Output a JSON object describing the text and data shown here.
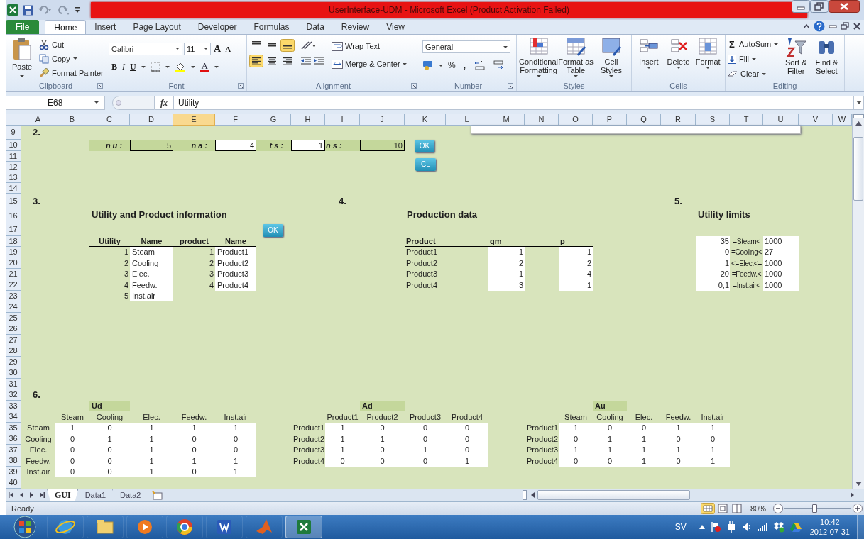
{
  "window": {
    "title": "UserInterface-UDM  -  Microsoft Excel (Product Activation Failed)"
  },
  "ribbon": {
    "tabs": [
      {
        "label": "File",
        "kind": "file",
        "selected": false
      },
      {
        "label": "Home",
        "kind": "tab",
        "selected": true
      },
      {
        "label": "Insert",
        "kind": "tab",
        "selected": false
      },
      {
        "label": "Page Layout",
        "kind": "tab",
        "selected": false
      },
      {
        "label": "Developer",
        "kind": "tab",
        "selected": false
      },
      {
        "label": "Formulas",
        "kind": "tab",
        "selected": false
      },
      {
        "label": "Data",
        "kind": "tab",
        "selected": false
      },
      {
        "label": "Review",
        "kind": "tab",
        "selected": false
      },
      {
        "label": "View",
        "kind": "tab",
        "selected": false
      }
    ],
    "clipboard": {
      "label": "Clipboard",
      "paste": "Paste",
      "cut": "Cut",
      "copy": "Copy",
      "format_painter": "Format Painter"
    },
    "font": {
      "label": "Font",
      "font_name": "Calibri",
      "font_size": "11",
      "grow": "A",
      "shrink": "A",
      "bold": "B",
      "italic": "I",
      "underline": "U",
      "font_color": "A"
    },
    "alignment": {
      "label": "Alignment",
      "vertical": [
        {
          "selected": false
        },
        {
          "selected": false
        },
        {
          "selected": true
        }
      ],
      "horizontal": [
        {
          "selected": true
        },
        {
          "selected": false
        },
        {
          "selected": false
        }
      ],
      "wrap_text": "Wrap Text",
      "merge_center": "Merge & Center"
    },
    "number": {
      "label": "Number",
      "format": "General",
      "percent": "%",
      "comma": ","
    },
    "styles": {
      "label": "Styles",
      "buttons": [
        "Conditional Formatting",
        "Format as Table",
        "Cell Styles"
      ]
    },
    "cells": {
      "label": "Cells",
      "buttons": [
        "Insert",
        "Delete",
        "Format"
      ]
    },
    "editing": {
      "label": "Editing",
      "autosum_symbol": "Σ",
      "autosum": "AutoSum",
      "fill": "Fill",
      "clear": "Clear",
      "sort_filter": "Sort & Filter",
      "find_select": "Find & Select"
    }
  },
  "formula_bar": {
    "name_box": "E68",
    "function_symbol": "fx",
    "formula": "Utility"
  },
  "sheet": {
    "columns": [
      {
        "label": "A",
        "selected": false
      },
      {
        "label": "B",
        "selected": false
      },
      {
        "label": "C",
        "selected": false
      },
      {
        "label": "D",
        "selected": false
      },
      {
        "label": "E",
        "selected": true
      },
      {
        "label": "F",
        "selected": false
      },
      {
        "label": "G",
        "selected": false
      },
      {
        "label": "H",
        "selected": false
      },
      {
        "label": "I",
        "selected": false
      },
      {
        "label": "J",
        "selected": false
      },
      {
        "label": "K",
        "selected": false
      },
      {
        "label": "L",
        "selected": false
      },
      {
        "label": "M",
        "selected": false
      },
      {
        "label": "N",
        "selected": false
      },
      {
        "label": "O",
        "selected": false
      },
      {
        "label": "P",
        "selected": false
      },
      {
        "label": "Q",
        "selected": false
      },
      {
        "label": "R",
        "selected": false
      },
      {
        "label": "S",
        "selected": false
      },
      {
        "label": "T",
        "selected": false
      },
      {
        "label": "U",
        "selected": false
      },
      {
        "label": "V",
        "selected": false
      },
      {
        "label": "W",
        "selected": false
      }
    ],
    "rows": [
      "9",
      "10",
      "11",
      "12",
      "13",
      "14",
      "15",
      "16",
      "17",
      "18",
      "19",
      "20",
      "21",
      "22",
      "23",
      "24",
      "25",
      "26",
      "27",
      "28",
      "29",
      "30",
      "31",
      "32",
      "33",
      "34",
      "35",
      "36",
      "37",
      "38",
      "39",
      "40"
    ],
    "section_2": {
      "number": "2.",
      "fields": [
        {
          "label": "nu:",
          "value": "5",
          "kind": "locked"
        },
        {
          "label": "na:",
          "value": "4",
          "kind": "input"
        },
        {
          "label": "ts:",
          "value": "1",
          "kind": "input"
        },
        {
          "label": "ns:",
          "value": "10",
          "kind": "locked"
        }
      ],
      "buttons": [
        "OK",
        "CL"
      ]
    },
    "section_3": {
      "number": "3.",
      "title": "Utility and Product information",
      "button": "OK",
      "columns": [
        "Utility",
        "Name",
        "product",
        "Name"
      ],
      "utilities": [
        {
          "number": "1",
          "name": "Steam"
        },
        {
          "number": "2",
          "name": "Cooling"
        },
        {
          "number": "3",
          "name": "Elec."
        },
        {
          "number": "4",
          "name": "Feedw."
        },
        {
          "number": "5",
          "name": "Inst.air"
        }
      ],
      "products": [
        {
          "number": "1",
          "name": "Product1"
        },
        {
          "number": "2",
          "name": "Product2"
        },
        {
          "number": "3",
          "name": "Product3"
        },
        {
          "number": "4",
          "name": "Product4"
        }
      ]
    },
    "section_4": {
      "number": "4.",
      "title": "Production data",
      "columns": [
        "Product",
        "qm",
        "p"
      ],
      "rows": [
        [
          "Product1",
          "1",
          "1"
        ],
        [
          "Product2",
          "2",
          "2"
        ],
        [
          "Product3",
          "1",
          "4"
        ],
        [
          "Product4",
          "3",
          "1"
        ]
      ]
    },
    "section_5": {
      "number": "5.",
      "title": "Utility limits",
      "rows": [
        {
          "lower": "35",
          "label": "=Steam<",
          "upper": "1000"
        },
        {
          "lower": "0",
          "label": "=Cooling<",
          "upper": "27"
        },
        {
          "lower": "1",
          "label": "<=Elec.<=",
          "upper": "1000"
        },
        {
          "lower": "20",
          "label": "=Feedw.<",
          "upper": "1000"
        },
        {
          "lower": "0,1",
          "label": "=Inst.air<",
          "upper": "1000"
        }
      ]
    },
    "section_6": {
      "number": "6.",
      "matrices": [
        {
          "name": "Ud",
          "columns": [
            "Steam",
            "Cooling",
            "Elec.",
            "Feedw.",
            "Inst.air"
          ],
          "rows": [
            {
              "label": "Steam",
              "values": [
                "1",
                "0",
                "1",
                "1",
                "1"
              ]
            },
            {
              "label": "Cooling",
              "values": [
                "0",
                "1",
                "1",
                "0",
                "0"
              ]
            },
            {
              "label": "Elec.",
              "values": [
                "0",
                "0",
                "1",
                "0",
                "0"
              ]
            },
            {
              "label": "Feedw.",
              "values": [
                "0",
                "0",
                "1",
                "1",
                "1"
              ]
            },
            {
              "label": "Inst.air",
              "values": [
                "0",
                "0",
                "1",
                "0",
                "1"
              ]
            }
          ]
        },
        {
          "name": "Ad",
          "columns": [
            "Product1",
            "Product2",
            "Product3",
            "Product4"
          ],
          "rows": [
            {
              "label": "Product1",
              "values": [
                "1",
                "0",
                "0",
                "0"
              ]
            },
            {
              "label": "Product2",
              "values": [
                "1",
                "1",
                "0",
                "0"
              ]
            },
            {
              "label": "Product3",
              "values": [
                "1",
                "0",
                "1",
                "0"
              ]
            },
            {
              "label": "Product4",
              "values": [
                "0",
                "0",
                "0",
                "1"
              ]
            }
          ]
        },
        {
          "name": "Au",
          "columns": [
            "Steam",
            "Cooling",
            "Elec.",
            "Feedw.",
            "Inst.air"
          ],
          "rows": [
            {
              "label": "Product1",
              "values": [
                "1",
                "0",
                "0",
                "1",
                "1"
              ]
            },
            {
              "label": "Product2",
              "values": [
                "0",
                "1",
                "1",
                "0",
                "0"
              ]
            },
            {
              "label": "Product3",
              "values": [
                "1",
                "1",
                "1",
                "1",
                "1"
              ]
            },
            {
              "label": "Product4",
              "values": [
                "0",
                "0",
                "1",
                "0",
                "1"
              ]
            }
          ]
        }
      ]
    }
  },
  "sheet_tabs": [
    {
      "label": "GUI",
      "selected": true
    },
    {
      "label": "Data1",
      "selected": false
    },
    {
      "label": "Data2",
      "selected": false
    }
  ],
  "status_bar": {
    "status": "Ready",
    "zoom": "80%",
    "level": 0.45
  },
  "taskbar": {
    "apps": [
      {
        "kind": "ie",
        "active": false
      },
      {
        "kind": "explorer",
        "active": false
      },
      {
        "kind": "media",
        "active": false
      },
      {
        "kind": "chrome",
        "active": false
      },
      {
        "kind": "word",
        "active": false
      },
      {
        "kind": "matlab",
        "active": false
      },
      {
        "kind": "excel",
        "active": true
      }
    ],
    "language": "SV",
    "time": "10:42",
    "date": "2012-07-31"
  }
}
